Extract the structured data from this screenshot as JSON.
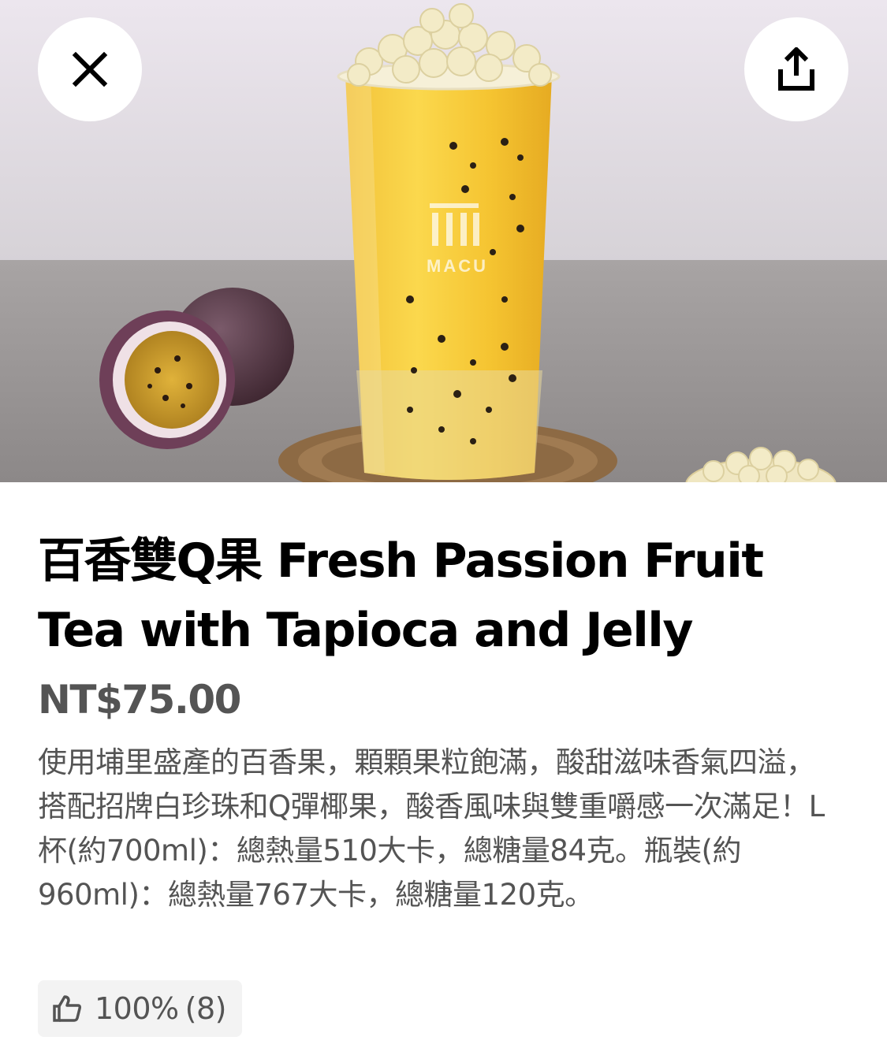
{
  "item": {
    "title": "百香雙Q果 Fresh Passion Fruit Tea with Tapioca and Jelly",
    "price": "NT$75.00",
    "description": "使用埔里盛產的百香果，顆顆果粒飽滿，酸甜滋味香氣四溢，搭配招牌白珍珠和Q彈椰果，酸香風味與雙重嚼感一次滿足！L杯(約700ml)：總熱量510大卡，總糖量84克。瓶裝(約960ml)：總熱量767大卡，總糖量120克。",
    "image_logo_text": "MACU"
  },
  "rating": {
    "percent": "100%",
    "count": "(8)",
    "icon": "thumbs-up-icon"
  },
  "controls": {
    "close_icon": "close-icon",
    "share_icon": "share-icon"
  },
  "colors": {
    "text_primary": "#000000",
    "text_secondary": "#545454",
    "chip_background": "#f3f3f3"
  }
}
